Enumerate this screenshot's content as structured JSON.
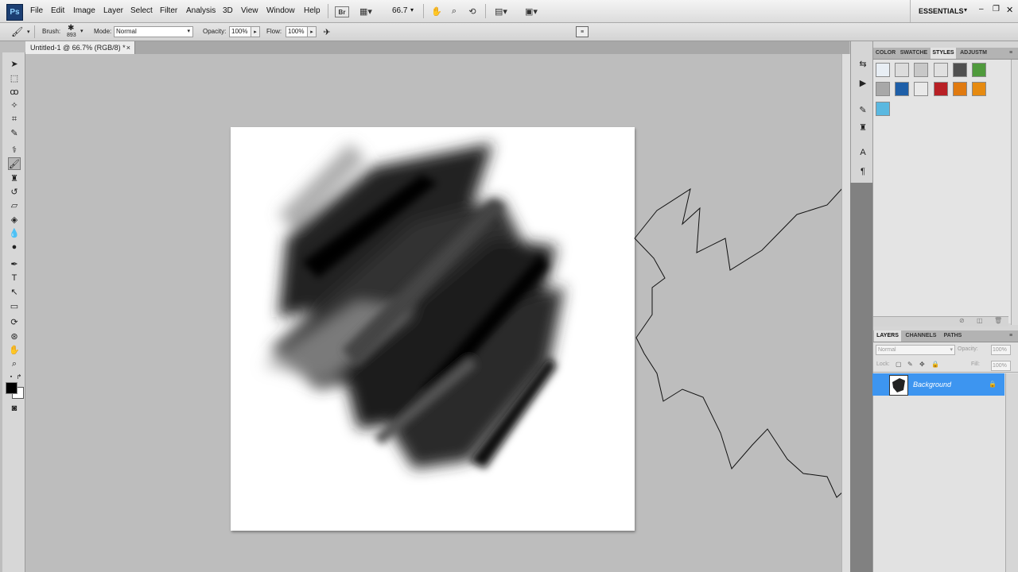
{
  "app": {
    "logo_text": "Ps",
    "workspace": "ESSENTIALS"
  },
  "menu": [
    "File",
    "Edit",
    "Image",
    "Layer",
    "Select",
    "Filter",
    "Analysis",
    "3D",
    "View",
    "Window",
    "Help"
  ],
  "menubar_tools": {
    "bridge_label": "Br",
    "zoom_value": "66.7"
  },
  "options": {
    "brush_label": "Brush:",
    "brush_size": "893",
    "mode_label": "Mode:",
    "mode_value": "Normal",
    "opacity_label": "Opacity:",
    "opacity_value": "100%",
    "flow_label": "Flow:",
    "flow_value": "100%"
  },
  "document": {
    "tab_title": "Untitled-1 @ 66.7% (RGB/8) *",
    "close": "×"
  },
  "styles_panel": {
    "tabs": [
      "COLOR",
      "SWATCHE",
      "STYLES",
      "ADJUSTM"
    ],
    "active_tab": "STYLES",
    "swatch_colors": [
      "#e8eef4",
      "#dcdcdc",
      "#c8c8c8",
      "#e0e0e0",
      "#505050",
      "#4f9a3c",
      "#a8a8a8",
      "#1e5fa8",
      "#e9e9e9",
      "#b82025",
      "#e07a10",
      "#e68a10",
      "#5ab8e0"
    ]
  },
  "layers_panel": {
    "tabs": [
      "LAYERS",
      "CHANNELS",
      "PATHS"
    ],
    "active_tab": "LAYERS",
    "blend_mode": "Normal",
    "opacity_label": "Opacity:",
    "opacity_value": "100%",
    "lock_label": "Lock:",
    "fill_label": "Fill:",
    "fill_value": "100%",
    "layers": [
      {
        "name": "Background",
        "visible": true,
        "locked": true
      }
    ]
  },
  "colors": {
    "selection": "#3d95f0",
    "foreground": "#000000",
    "background": "#ffffff"
  }
}
